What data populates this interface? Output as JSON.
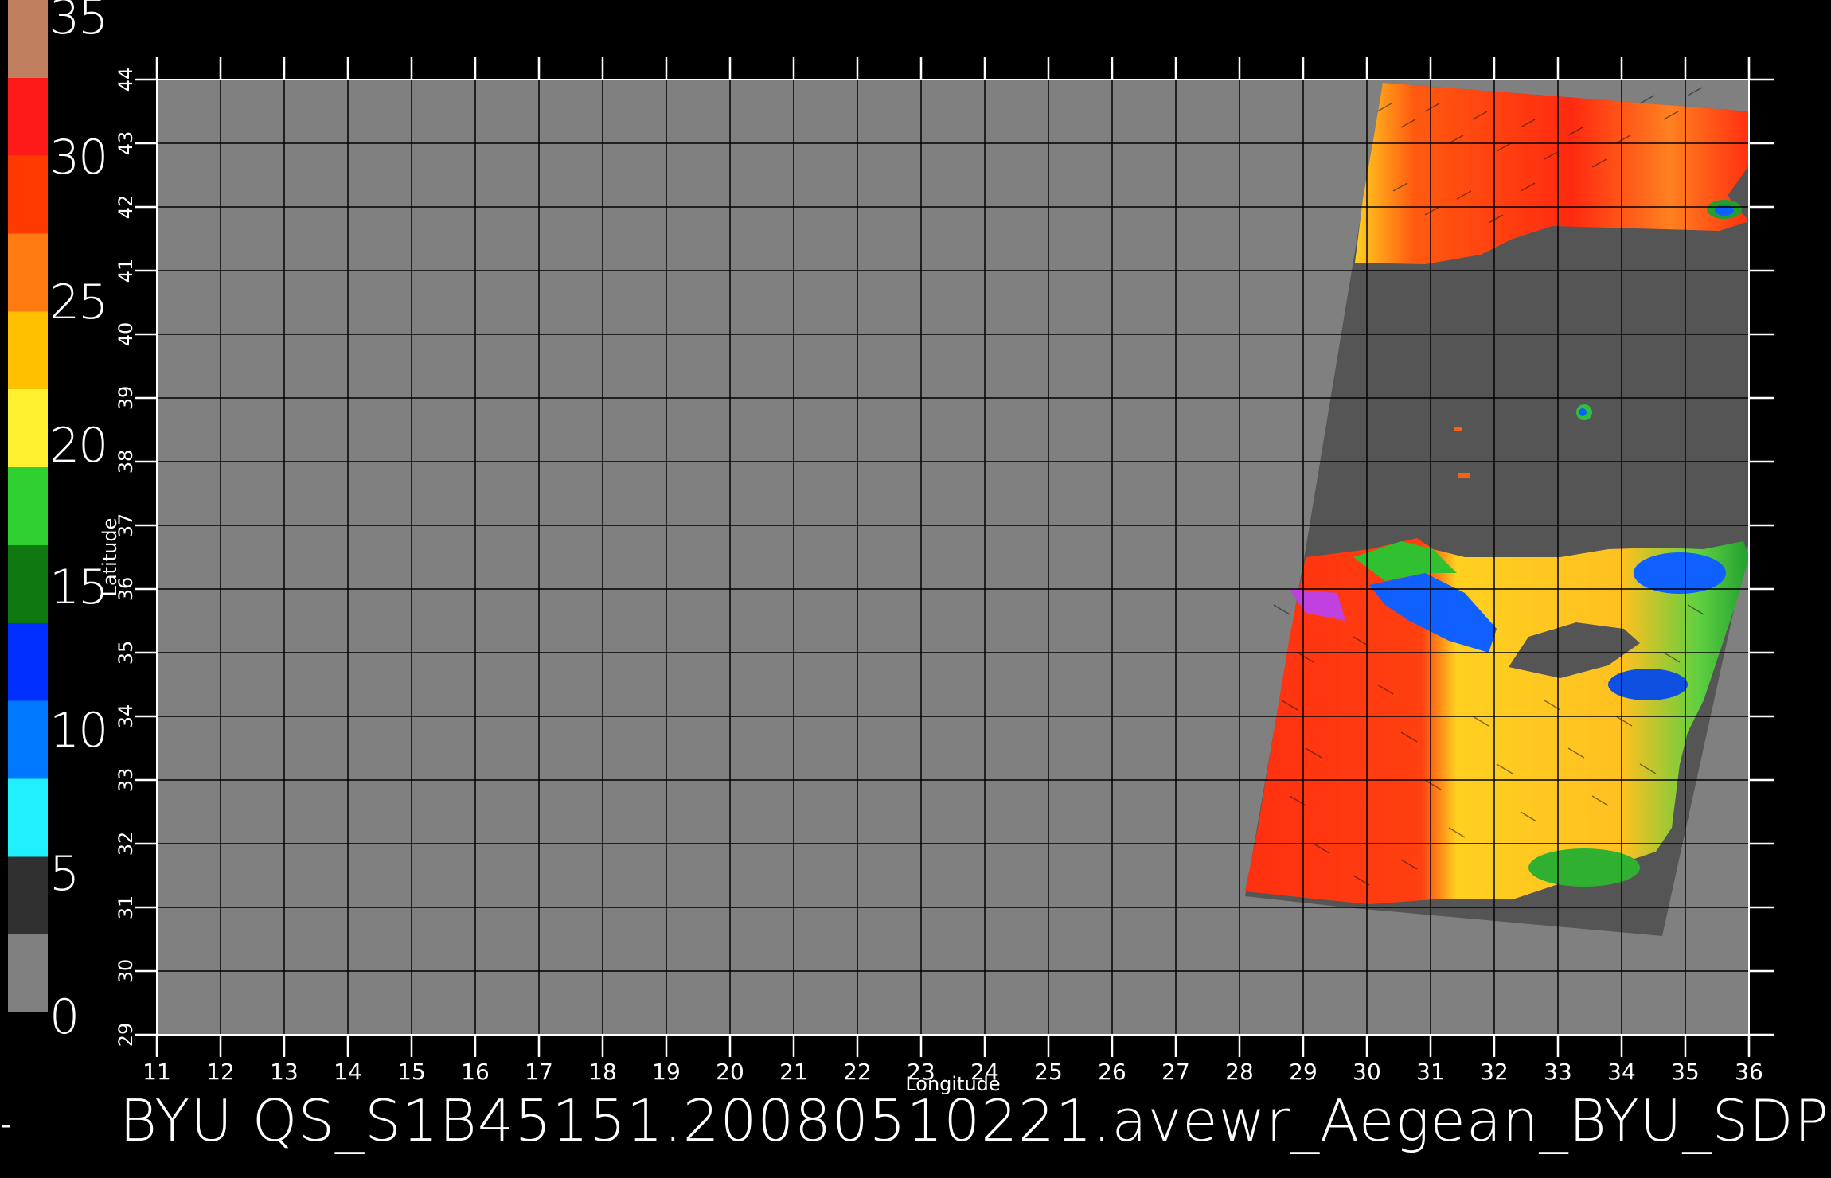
{
  "colorbar": {
    "ticks": [
      "35",
      "30",
      "25",
      "20",
      "15",
      "10",
      "5",
      "0"
    ],
    "colors": [
      "#c08060",
      "#ff1a1a",
      "#ff3a00",
      "#ff7a10",
      "#ffc000",
      "#fff030",
      "#30d030",
      "#107810",
      "#0030ff",
      "#0078ff",
      "#20f0ff",
      "#303030",
      "#808080"
    ]
  },
  "map": {
    "background_color": "#808080",
    "swath_color": "#555555",
    "ylabel": "Latitude",
    "xlabel": "Longitude",
    "lon_ticks": [
      "11",
      "12",
      "13",
      "14",
      "15",
      "16",
      "17",
      "18",
      "19",
      "20",
      "21",
      "22",
      "23",
      "24",
      "25",
      "26",
      "27",
      "28",
      "29",
      "30",
      "31",
      "32",
      "33",
      "34",
      "35",
      "36"
    ],
    "lat_ticks": [
      "29",
      "30",
      "31",
      "32",
      "33",
      "34",
      "35",
      "36",
      "37",
      "38",
      "39",
      "40",
      "41",
      "42",
      "43",
      "44"
    ]
  },
  "footer": {
    "title": "BYU  QS_S1B45151.20080510221.avewr_Aegean_BYU_SDP"
  },
  "left_mark": "-"
}
